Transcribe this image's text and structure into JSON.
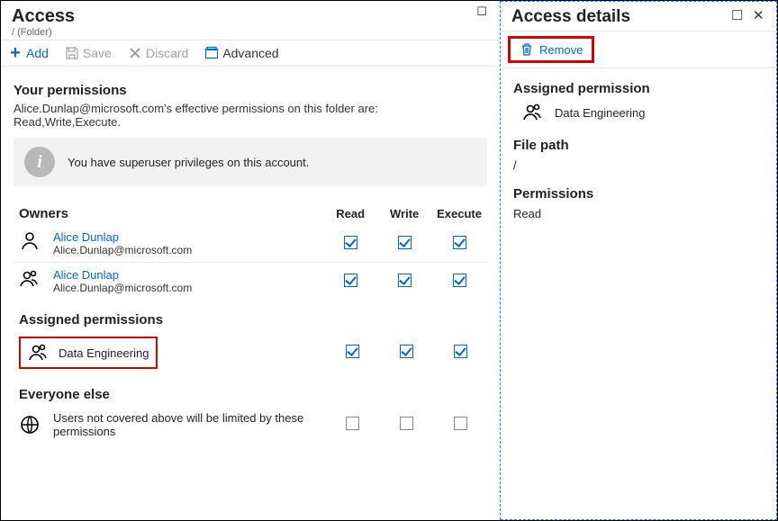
{
  "main": {
    "title": "Access",
    "subtitle": "/ (Folder)",
    "toolbar": {
      "add": "Add",
      "save": "Save",
      "discard": "Discard",
      "advanced": "Advanced"
    },
    "yourPerm": {
      "title": "Your permissions",
      "text": "Alice.Dunlap@microsoft.com's effective permissions on this folder are: Read,Write,Execute."
    },
    "info": "You have superuser privileges on this account.",
    "cols": {
      "read": "Read",
      "write": "Write",
      "exec": "Execute"
    },
    "owners": {
      "title": "Owners",
      "rows": [
        {
          "name": "Alice Dunlap",
          "email": "Alice.Dunlap@microsoft.com",
          "icon": "person",
          "r": true,
          "w": true,
          "x": true
        },
        {
          "name": "Alice Dunlap",
          "email": "Alice.Dunlap@microsoft.com",
          "icon": "group",
          "r": true,
          "w": true,
          "x": true
        }
      ]
    },
    "assigned": {
      "title": "Assigned permissions",
      "rows": [
        {
          "name": "Data Engineering",
          "icon": "group",
          "r": true,
          "w": true,
          "x": true,
          "highlight": true
        }
      ]
    },
    "everyone": {
      "title": "Everyone else",
      "text": "Users not covered above will be limited by these permissions"
    }
  },
  "side": {
    "title": "Access details",
    "remove": "Remove",
    "assignedPerm": {
      "title": "Assigned permission",
      "value": "Data Engineering"
    },
    "filePath": {
      "title": "File path",
      "value": "/"
    },
    "permissions": {
      "title": "Permissions",
      "value": "Read"
    }
  }
}
